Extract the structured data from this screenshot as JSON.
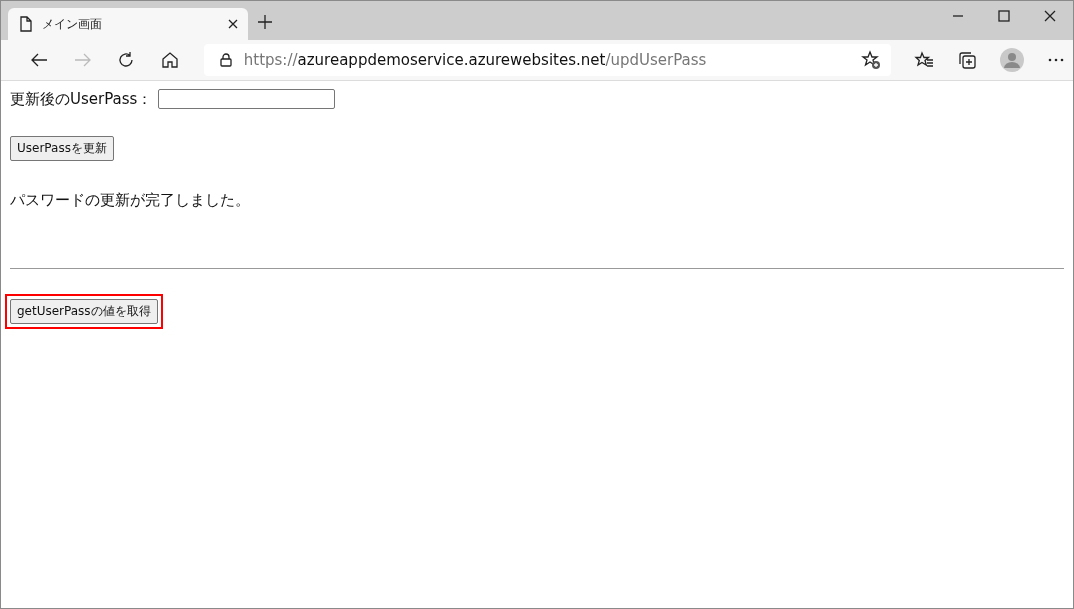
{
  "browser": {
    "tab": {
      "title": "メイン画面"
    },
    "address_bar": {
      "scheme": "https://",
      "host": "azureappdemoservice.azurewebsites.net",
      "path": "/updUserPass"
    }
  },
  "page": {
    "field": {
      "label": "更新後のUserPass："
    },
    "update_button": {
      "label": "UserPassを更新",
      "highlighted": false
    },
    "message": "パスワードの更新が完了しました。",
    "get_button": {
      "label": "getUserPassの値を取得",
      "highlighted": true
    }
  }
}
